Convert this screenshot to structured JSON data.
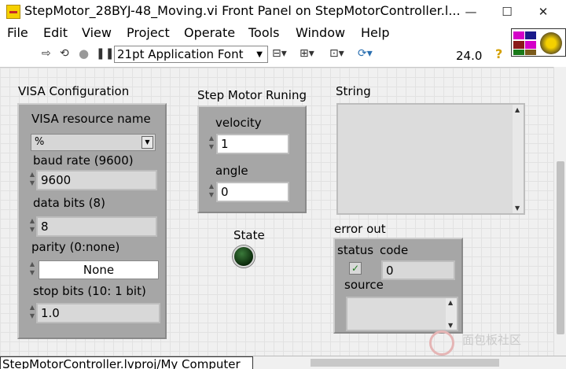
{
  "window": {
    "title": "StepMotor_28BYJ-48_Moving.vi Front Panel on StepMotorController.l...",
    "minimize": "—",
    "maximize": "☐",
    "close": "✕"
  },
  "menu": [
    "File",
    "Edit",
    "View",
    "Project",
    "Operate",
    "Tools",
    "Window",
    "Help"
  ],
  "toolbar": {
    "font": "21pt Application Font",
    "zoom": "24.0",
    "icons": [
      "run-arrow-icon",
      "run-continuous-icon",
      "abort-icon",
      "pause-icon",
      "align-icon",
      "distribute-icon",
      "resize-icon",
      "reorder-icon"
    ]
  },
  "visa": {
    "title": "VISA Configuration",
    "resource_label": "VISA resource name",
    "resource_value": "%",
    "baud_label": "baud rate (9600)",
    "baud_value": "9600",
    "data_bits_label": "data bits (8)",
    "data_bits_value": "8",
    "parity_label": "parity (0:none)",
    "parity_value": "None",
    "stop_bits_label": "stop bits (10: 1 bit)",
    "stop_bits_value": "1.0"
  },
  "motor": {
    "title": "Step Motor Runing",
    "velocity_label": "velocity",
    "velocity_value": "1",
    "angle_label": "angle",
    "angle_value": "0"
  },
  "state": {
    "label": "State"
  },
  "string": {
    "label": "String"
  },
  "error_out": {
    "title": "error out",
    "status_label": "status",
    "code_label": "code",
    "code_value": "0",
    "source_label": "source"
  },
  "statusbar": {
    "path": "StepMotorController.lvproj/My Computer"
  },
  "watermark": "面包板社区",
  "colors": {
    "panel_bg": "#f0f0f0",
    "cluster": "#a6a6a6",
    "led_off": "#0c2a0c"
  }
}
